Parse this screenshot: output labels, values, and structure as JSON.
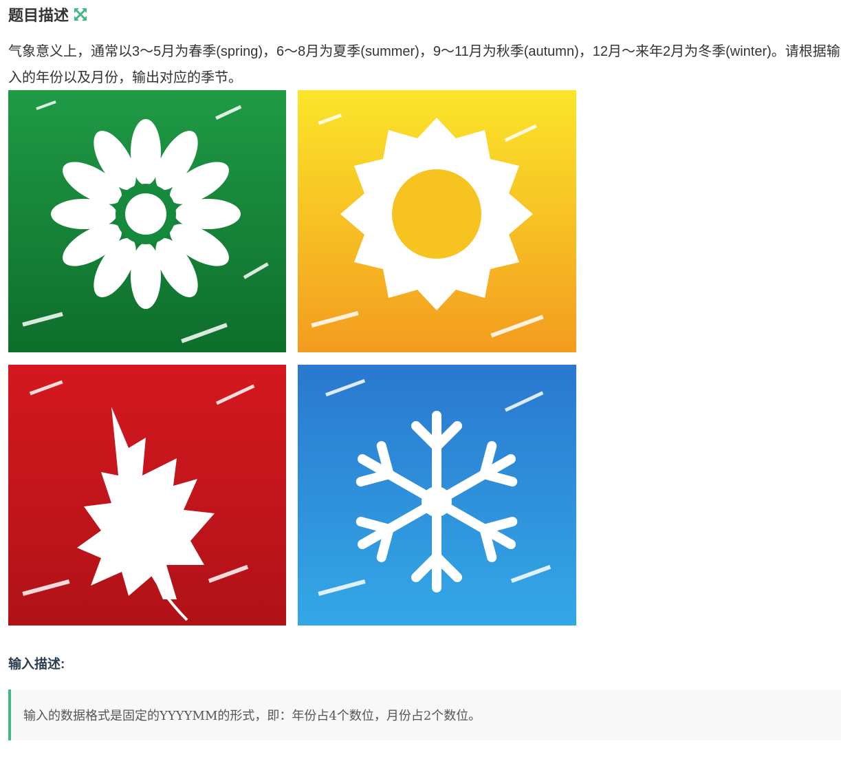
{
  "problem": {
    "title": "题目描述",
    "title_icon": "expand-arrows-icon",
    "description": "气象意义上，通常以3～5月为春季(spring)，6～8月为夏季(summer)，9～11月为秋季(autumn)，12月～来年2月为冬季(winter)。请根据输入的年份以及月份，输出对应的季节。",
    "image_icons": [
      "flower-icon",
      "sun-icon",
      "maple-leaf-icon",
      "snowflake-icon"
    ]
  },
  "input": {
    "title": "输入描述:",
    "text": "输入的数据格式是固定的YYYYMM的形式，即：年份占4个数位，月份占2个数位。"
  },
  "colors": {
    "accent": "#42b983",
    "spring_green": "#1a8a3c",
    "summer_yellow": "#f6b71d",
    "autumn_red": "#c8161c",
    "winter_blue": "#2a86d4"
  }
}
